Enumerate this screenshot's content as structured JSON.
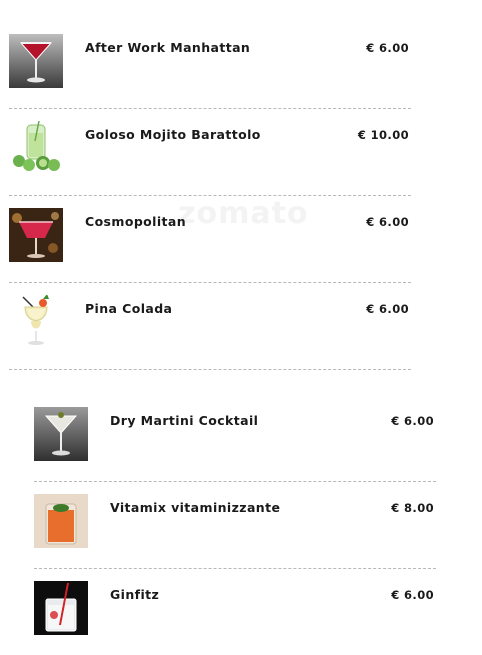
{
  "watermark": "zomato",
  "menu": {
    "block1": [
      {
        "name": "After Work Manhattan",
        "price": "€ 6.00",
        "icon": "martini-red-icon"
      },
      {
        "name": "Goloso Mojito Barattolo",
        "price": "€ 10.00",
        "icon": "mojito-jar-icon"
      },
      {
        "name": "Cosmopolitan",
        "price": "€ 6.00",
        "icon": "cosmopolitan-icon"
      },
      {
        "name": "Pina Colada",
        "price": "€ 6.00",
        "icon": "pina-colada-icon"
      }
    ],
    "block2": [
      {
        "name": "Dry Martini Cocktail",
        "price": "€ 6.00",
        "icon": "dry-martini-icon"
      },
      {
        "name": "Vitamix vitaminizzante",
        "price": "€ 8.00",
        "icon": "orange-drink-icon"
      },
      {
        "name": "Ginfitz",
        "price": "€ 6.00",
        "icon": "ginfitz-icon"
      }
    ]
  }
}
